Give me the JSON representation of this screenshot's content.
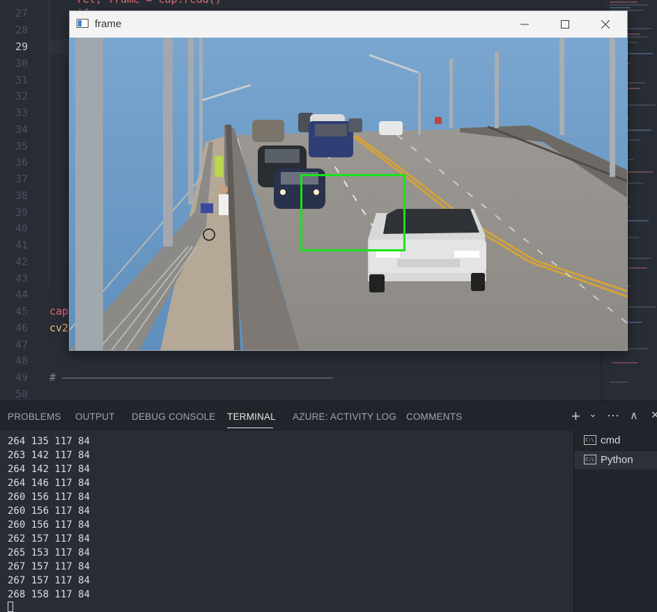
{
  "editor": {
    "line_numbers": [
      "27",
      "28",
      "29",
      "30",
      "31",
      "32",
      "33",
      "34",
      "35",
      "36",
      "37",
      "38",
      "39",
      "40",
      "41",
      "42",
      "43",
      "44",
      "45",
      "46",
      "47",
      "48",
      "49",
      "50"
    ],
    "active_line": "29",
    "visible_code": {
      "line27_a": "ret, frame = cap.read()",
      "line28_a": "if ...",
      "line45": "cap",
      "line46": "cv2",
      "line49": "# ———————————————————————————————————————————"
    }
  },
  "frame_window": {
    "title": "frame",
    "minimize_icon": "minimize-icon",
    "maximize_icon": "maximize-icon",
    "close_icon": "close-icon",
    "box_color": "#18e418"
  },
  "panel": {
    "tabs": [
      {
        "label": "PROBLEMS"
      },
      {
        "label": "OUTPUT"
      },
      {
        "label": "DEBUG CONSOLE"
      },
      {
        "label": "TERMINAL"
      },
      {
        "label": "AZURE: ACTIVITY LOG"
      },
      {
        "label": "COMMENTS"
      }
    ],
    "active_tab": "TERMINAL",
    "actions": {
      "add": "+",
      "dropdown": "⌄",
      "more": "⋯",
      "maximize": "∧",
      "close": "✕"
    }
  },
  "terminal": {
    "lines": [
      "264 135 117 84",
      "263 142 117 84",
      "264 142 117 84",
      "264 146 117 84",
      "260 156 117 84",
      "260 156 117 84",
      "260 156 117 84",
      "262 157 117 84",
      "265 153 117 84",
      "267 157 117 84",
      "267 157 117 84",
      "268 158 117 84"
    ],
    "instances": [
      {
        "label": "cmd",
        "icon": "cmd-icon"
      },
      {
        "label": "Python",
        "icon": "cmd-icon"
      }
    ],
    "selected_instance": "Python"
  }
}
